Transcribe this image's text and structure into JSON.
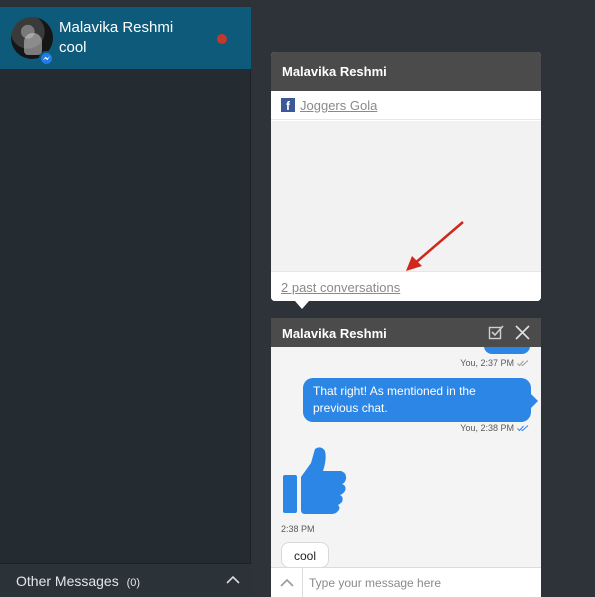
{
  "sidebar": {
    "conversation": {
      "name": "Malavika Reshmi",
      "preview": "cool",
      "avatar_icon": "user-avatar",
      "badge_icon": "messenger-icon",
      "unread_color": "#c2392b"
    },
    "other_messages": {
      "label": "Other Messages",
      "count": "(0)",
      "icon": "chevron-up-icon"
    }
  },
  "profile_card": {
    "title": "Malavika Reshmi",
    "page_icon": "facebook-icon",
    "page_link": "Joggers Gola",
    "past_conversations": "2 past conversations",
    "annotation_color": "#d0271d"
  },
  "chat": {
    "title": "Malavika Reshmi",
    "messages": [
      {
        "direction": "out",
        "text": "",
        "meta": "You, 2:37 PM"
      },
      {
        "direction": "out",
        "text": "That right! As mentioned in the previous chat.",
        "meta": "You, 2:38 PM"
      },
      {
        "direction": "in",
        "type": "thumbs-up",
        "meta": "2:38 PM"
      },
      {
        "direction": "in",
        "text": "cool"
      }
    ],
    "input": {
      "placeholder": "Type your message here",
      "value": ""
    },
    "accent_color": "#2b86e6"
  }
}
